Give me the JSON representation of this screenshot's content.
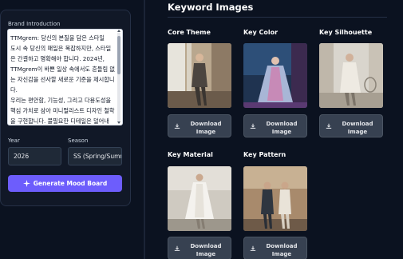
{
  "sidebar": {
    "brand_label": "Brand Introduction",
    "brand_text": "TTMgrem: 당신의 본질을 담은 스타일\n도시 속 당신의 매일은 복잡하지만, 스타일은 간결하고 명확해야 합니다. 2024년, TTMgrem이 바쁜 일상 속에서도 흔들림 없는 자신감을 선사할 새로운 기준을 제시합니다.\n우리는 편안함, 기능성, 그리고 다용도성을 핵심 가치로 삼아 미니멀리스트 디자인 철학을 구현합니다. 불필요한 디테일은 덜어내 정교한 실루엣으",
    "year_label": "Year",
    "year_value": "2026",
    "season_label": "Season",
    "season_value": "SS (Spring/Summer)",
    "generate_label": "Generate Mood Board",
    "accent_color": "#6d5dfc"
  },
  "main": {
    "title": "Keyword Images",
    "download_label": "Download Image",
    "cards": [
      {
        "title": "Core Theme",
        "icon": "download-icon"
      },
      {
        "title": "Key Color",
        "icon": "download-icon"
      },
      {
        "title": "Key Silhouette",
        "icon": "download-icon"
      },
      {
        "title": "Key Material",
        "icon": "download-icon"
      },
      {
        "title": "Key Pattern",
        "icon": "download-icon"
      }
    ]
  }
}
